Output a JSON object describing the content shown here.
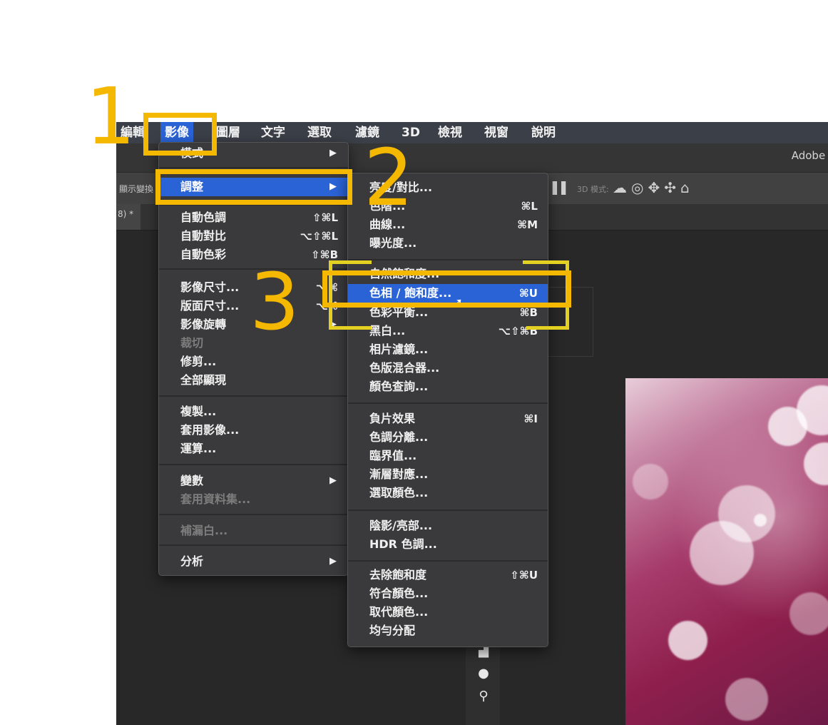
{
  "menubar": {
    "items": [
      {
        "label": "編輯"
      },
      {
        "label": "影像"
      },
      {
        "label": "圖層"
      },
      {
        "label": "文字"
      },
      {
        "label": "選取"
      },
      {
        "label": "濾鏡"
      },
      {
        "label": "3D"
      },
      {
        "label": "檢視"
      },
      {
        "label": "視窗"
      },
      {
        "label": "說明"
      }
    ]
  },
  "title": "Adobe P",
  "options": {
    "left_text": "顯示變換",
    "mode_label": "3D 模式:",
    "tab_text": "8) *"
  },
  "image_menu": {
    "items": [
      {
        "label": "模式",
        "arrow": "▶"
      },
      {
        "label": "調整",
        "arrow": "▶"
      },
      {
        "label": "自動色調",
        "shortcut": "⇧⌘L"
      },
      {
        "label": "自動對比",
        "shortcut": "⌥⇧⌘L"
      },
      {
        "label": "自動色彩",
        "shortcut": "⇧⌘B"
      },
      {
        "label": "影像尺寸...",
        "shortcut": "⌥⌘"
      },
      {
        "label": "版面尺寸...",
        "shortcut": "⌥⌘"
      },
      {
        "label": "影像旋轉",
        "arrow": "▶"
      },
      {
        "label": "裁切"
      },
      {
        "label": "修剪..."
      },
      {
        "label": "全部顯現"
      },
      {
        "label": "複製..."
      },
      {
        "label": "套用影像..."
      },
      {
        "label": "運算..."
      },
      {
        "label": "變數",
        "arrow": "▶"
      },
      {
        "label": "套用資料集..."
      },
      {
        "label": "補漏白..."
      },
      {
        "label": "分析",
        "arrow": "▶"
      }
    ]
  },
  "adjust_menu": {
    "items": [
      {
        "label": "亮度/對比..."
      },
      {
        "label": "色階...",
        "shortcut": "⌘L"
      },
      {
        "label": "曲線...",
        "shortcut": "⌘M"
      },
      {
        "label": "曝光度..."
      },
      {
        "label": "自然飽和度..."
      },
      {
        "label": "色相 / 飽和度...",
        "shortcut": "⌘U"
      },
      {
        "label": "色彩平衡...",
        "shortcut": "⌘B"
      },
      {
        "label": "黑白...",
        "shortcut": "⌥⇧⌘B"
      },
      {
        "label": "相片濾鏡..."
      },
      {
        "label": "色版混合器..."
      },
      {
        "label": "顏色查詢..."
      },
      {
        "label": "負片效果",
        "shortcut": "⌘I"
      },
      {
        "label": "色調分離..."
      },
      {
        "label": "臨界值..."
      },
      {
        "label": "漸層對應..."
      },
      {
        "label": "選取顏色..."
      },
      {
        "label": "陰影/亮部..."
      },
      {
        "label": "HDR 色調..."
      },
      {
        "label": "去除飽和度",
        "shortcut": "⇧⌘U"
      },
      {
        "label": "符合顏色..."
      },
      {
        "label": "取代顏色..."
      },
      {
        "label": "均勻分配"
      }
    ]
  },
  "annotations": [
    "1",
    "2",
    "3"
  ],
  "colors": {
    "accent": "#2a63d6",
    "annotation": "#f5b800",
    "menu_bg": "#3a3a3c"
  }
}
